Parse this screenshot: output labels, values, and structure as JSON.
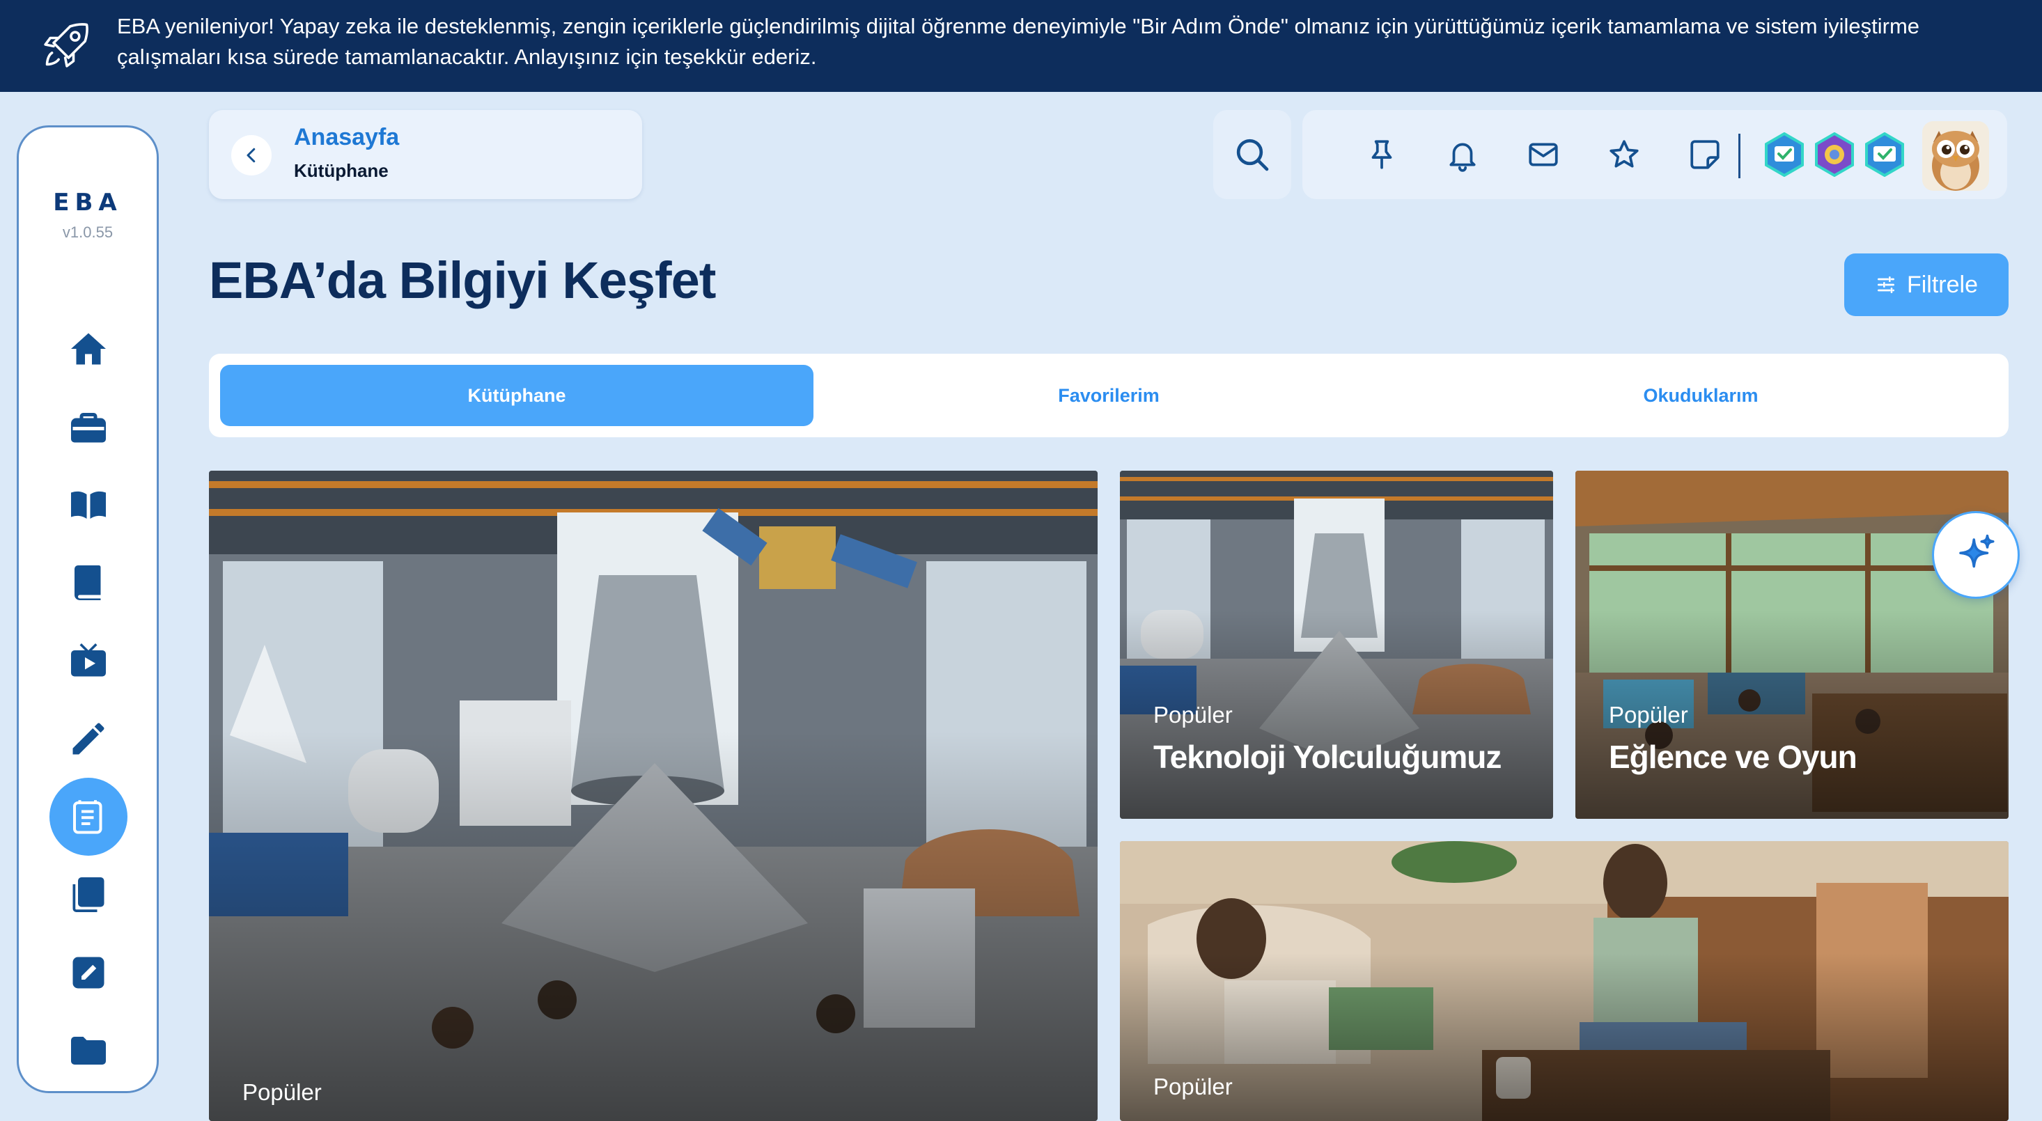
{
  "banner": {
    "text": "EBA yenileniyor! Yapay zeka ile desteklenmiş, zengin içeriklerle güçlendirilmiş dijital öğrenme deneyimiyle \"Bir Adım Önde\" olmanız için yürüttüğümüz içerik tamamlama ve sistem iyileştirme çalışmaları kısa sürede tamamlanacaktır. Anlayışınız için teşekkür ederiz.",
    "icon": "rocket-icon"
  },
  "sidebar": {
    "logo": "EBA",
    "version": "v1.0.55",
    "items": [
      {
        "icon": "home-icon",
        "active": false
      },
      {
        "icon": "briefcase-icon",
        "active": false
      },
      {
        "icon": "open-book-icon",
        "active": false
      },
      {
        "icon": "book-icon",
        "active": false
      },
      {
        "icon": "tv-icon",
        "active": false
      },
      {
        "icon": "pencil-icon",
        "active": false
      },
      {
        "icon": "library-icon",
        "active": true
      },
      {
        "icon": "copy-icon",
        "active": false
      },
      {
        "icon": "edit-note-icon",
        "active": false
      },
      {
        "icon": "folder-icon",
        "active": false
      }
    ]
  },
  "breadcrumb": {
    "parent": "Anasayfa",
    "current": "Kütüphane"
  },
  "toolbar": {
    "icons": [
      "search-icon",
      "pin-icon",
      "bell-icon",
      "mail-icon",
      "star-icon",
      "sticky-note-icon"
    ],
    "badges": [
      "badge-1",
      "badge-2",
      "badge-3"
    ],
    "avatar": "owl-avatar"
  },
  "main": {
    "title": "EBA’da Bilgiyi Keşfet",
    "filter_label": "Filtrele",
    "tabs": [
      {
        "label": "Kütüphane",
        "active": true
      },
      {
        "label": "Favorilerim",
        "active": false
      },
      {
        "label": "Okuduklarım",
        "active": false
      }
    ],
    "cards": [
      {
        "tag": "Popüler",
        "title": ""
      },
      {
        "tag": "Popüler",
        "title": "Teknoloji Yolculuğumuz"
      },
      {
        "tag": "Popüler",
        "title": "Eğlence ve Oyun"
      },
      {
        "tag": "Popüler",
        "title": ""
      }
    ]
  },
  "colors": {
    "brand_dark": "#0d2d5c",
    "accent": "#4aa6fa",
    "background": "#dbe9f8"
  }
}
